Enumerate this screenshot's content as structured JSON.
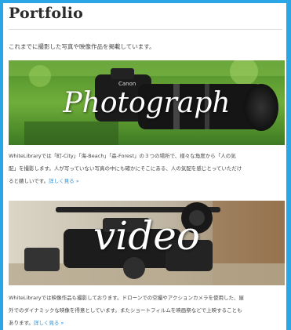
{
  "page": {
    "title": "Portfolio",
    "intro": "これまでに撮影した写真や映像作品を掲載しています。"
  },
  "cards": [
    {
      "overlay_title": "Photograph",
      "camera_brand": "Canon",
      "desc_lines": [
        "WhiteLibraryでは「町-City」「海-Beach」「森-Forest」の３つの場所で、様々な角度から「人の気",
        "配」を撮影します。人が写っていない写真の中にも確かにそこにある、人の気配を感じとっていただけ",
        "ると嬉しいです。"
      ],
      "more_label": "詳しく見る »"
    },
    {
      "overlay_title": "video",
      "desc_lines": [
        "WhiteLibraryでは映像作品も撮影しております。ドローンでの空撮やアクションカメラを使用した、屋",
        "外でのダイナミックな映像を得意としています。またショートフィルムを映画祭などで上映することも",
        "あります。"
      ],
      "more_label": "詳しく見る »"
    }
  ],
  "colors": {
    "frame_border": "#2aa5e6",
    "link": "#2a8fd6",
    "title_text": "#2b2b2b"
  }
}
